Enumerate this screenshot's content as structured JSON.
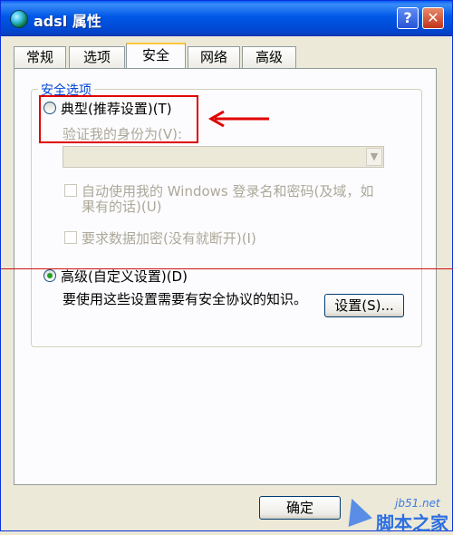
{
  "window": {
    "title": "adsl 属性",
    "help_label": "?",
    "close_label": "✕"
  },
  "tabs": [
    "常规",
    "选项",
    "安全",
    "网络",
    "高级"
  ],
  "security": {
    "group_label": "安全选项",
    "typical_label": "典型(推荐设置)(T)",
    "verify_label": "验证我的身份为(V):",
    "auto_login_line1": "自动使用我的 Windows 登录名和密码(及域，如",
    "auto_login_line2": "果有的话)(U)",
    "encryption_label": "要求数据加密(没有就断开)(I)",
    "advanced_label": "高级(自定义设置)(D)",
    "advanced_desc": "要使用这些设置需要有安全协议的知识。",
    "settings_button": "设置(S)..."
  },
  "footer": {
    "ok_button": "确定"
  },
  "watermark": {
    "site": "jb51.net",
    "name": "脚本之家"
  },
  "colors": {
    "highlight": "#e00000",
    "group_label": "#0046d5"
  }
}
